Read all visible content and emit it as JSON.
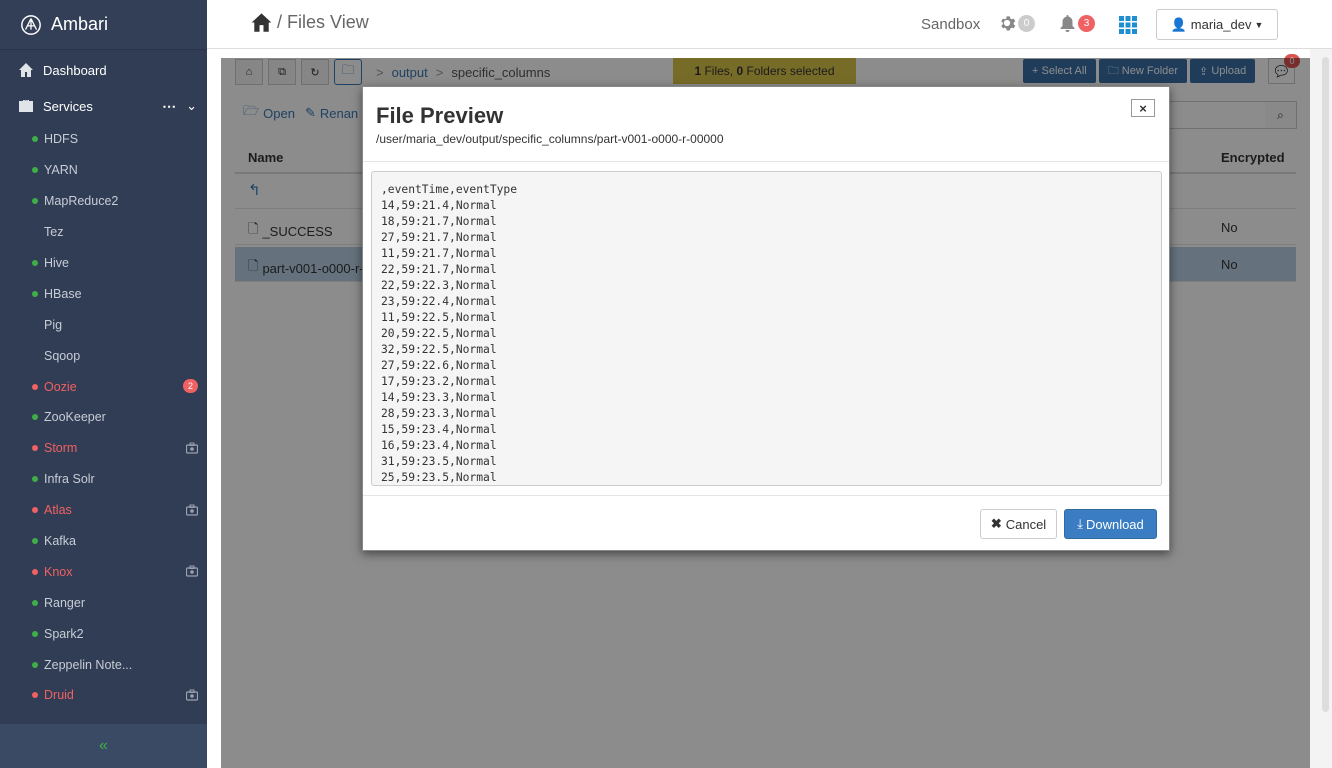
{
  "brand": {
    "name": "Ambari"
  },
  "sidebar": {
    "dashboard_label": "Dashboard",
    "services_label": "Services",
    "services": [
      {
        "name": "HDFS",
        "status": "green"
      },
      {
        "name": "YARN",
        "status": "green"
      },
      {
        "name": "MapReduce2",
        "status": "green"
      },
      {
        "name": "Tez",
        "status": "none"
      },
      {
        "name": "Hive",
        "status": "green"
      },
      {
        "name": "HBase",
        "status": "green"
      },
      {
        "name": "Pig",
        "status": "none"
      },
      {
        "name": "Sqoop",
        "status": "none"
      },
      {
        "name": "Oozie",
        "status": "red",
        "badge": "2"
      },
      {
        "name": "ZooKeeper",
        "status": "green"
      },
      {
        "name": "Storm",
        "status": "red",
        "maintenance": true
      },
      {
        "name": "Infra Solr",
        "status": "green"
      },
      {
        "name": "Atlas",
        "status": "red",
        "maintenance": true
      },
      {
        "name": "Kafka",
        "status": "green"
      },
      {
        "name": "Knox",
        "status": "red",
        "maintenance": true
      },
      {
        "name": "Ranger",
        "status": "green"
      },
      {
        "name": "Spark2",
        "status": "green"
      },
      {
        "name": "Zeppelin Note...",
        "status": "green"
      },
      {
        "name": "Druid",
        "status": "red",
        "maintenance": true
      }
    ],
    "collapse_glyph": "«"
  },
  "topbar": {
    "separator": "/",
    "title": "Files View",
    "cluster": "Sandbox",
    "ops_count": "0",
    "alerts_count": "3",
    "user": "maria_dev"
  },
  "toolbar": {
    "breadcrumb": [
      "output",
      "specific_columns"
    ],
    "breadcrumb_sep": ">",
    "selection": {
      "files": "1",
      "files_label": " Files, ",
      "folders": "0",
      "folders_label": " Folders selected"
    },
    "select_all": "Select All",
    "new_folder": "New Folder",
    "upload": "Upload",
    "chat_count": "0",
    "open": "Open",
    "rename": "Renan"
  },
  "table": {
    "headers": {
      "name": "Name",
      "encrypted": "Encrypted"
    },
    "rows": [
      {
        "name": "_SUCCESS",
        "encrypted": "No"
      },
      {
        "name": "part-v001-o000-r-",
        "encrypted": "No"
      }
    ]
  },
  "modal": {
    "title": "File Preview",
    "path": "/user/maria_dev/output/specific_columns/part-v001-o000-r-00000",
    "close_glyph": "×",
    "lines": [
      ",eventTime,eventType",
      "14,59:21.4,Normal",
      "18,59:21.7,Normal",
      "27,59:21.7,Normal",
      "11,59:21.7,Normal",
      "22,59:21.7,Normal",
      "22,59:22.3,Normal",
      "23,59:22.4,Normal",
      "11,59:22.5,Normal",
      "20,59:22.5,Normal",
      "32,59:22.5,Normal",
      "27,59:22.6,Normal",
      "17,59:23.2,Normal",
      "14,59:23.3,Normal",
      "28,59:23.3,Normal",
      "15,59:23.4,Normal",
      "16,59:23.4,Normal",
      "31,59:23.5,Normal",
      "25,59:23.5,Normal"
    ],
    "cancel": "Cancel",
    "download": "Download"
  },
  "colors": {
    "sidebar_bg": "#313d54",
    "status_green": "#3fae49",
    "status_red": "#ef6162",
    "primary_blue": "#3a7dc2"
  }
}
